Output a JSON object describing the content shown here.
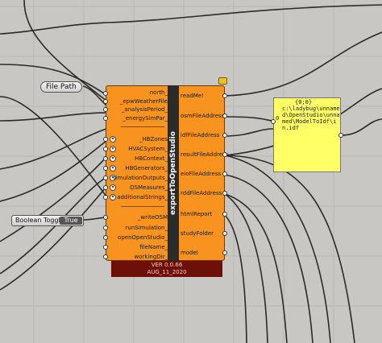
{
  "window": {
    "background": "#c8c7c3"
  },
  "file_path_chip": {
    "label": "File Path"
  },
  "component": {
    "name": "exportToOpenStudio",
    "color": "#f7931e",
    "inputs": [
      "north_",
      "_epwWeatherFile",
      "_analysisPeriod_",
      "_energySimPar_",
      "_HBZones",
      "HVACSystem_",
      "HBContext_",
      "HBGenerators_",
      "simulationOutputs_",
      "OSMeasures_",
      "additionalStrings_",
      "_writeOSM",
      "runSimulation_",
      "openOpenStudio_",
      "fileName_",
      "workingDir_"
    ],
    "outputs": [
      "readMe!",
      "osmFileAddress",
      "idfFileAddress",
      "resultFileAddress",
      "eioFileAddress",
      "rddFileAddress",
      "htmlReport",
      "studyFolder",
      "model"
    ],
    "version": "VER 0.0.66",
    "date": "AUG_11_2020"
  },
  "panel": {
    "index": "{0;0}",
    "row": "0",
    "text": "c:\\ladybug\\unnamed\\OpenStudio\\unnamed\\ModelToIdf\\in.idf",
    "color": "#ffff66"
  },
  "boolean_toggle": {
    "label": "Boolean Toggle",
    "value": "True"
  }
}
